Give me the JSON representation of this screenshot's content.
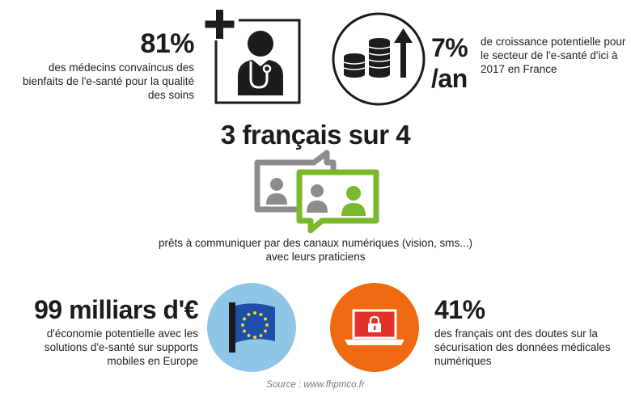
{
  "stats": {
    "doctors": {
      "value": "81%",
      "description": "des médecins convaincus des bienfaits de l'e-santé pour la qualité des soins"
    },
    "growth": {
      "value_line1": "7%",
      "value_line2": "/an",
      "description": "de croissance potentielle pour le secteur de l'e-santé d'ici à 2017 en France"
    },
    "communication": {
      "value": "3 français sur 4",
      "description": "prêts à communiquer par des canaux numériques (vision, sms...) avec leurs praticiens"
    },
    "savings": {
      "value": "99 milliars d'€",
      "description": "d'économie potentielle avec les solutions d'e-santé sur supports mobiles en Europe"
    },
    "security": {
      "value": "41%",
      "description": "des français ont des doutes sur la sécurisation des données médicales numériques"
    }
  },
  "source": "Source : www.fhpmco.fr",
  "colors": {
    "text": "#1c1c1c",
    "green": "#7ab929",
    "gray": "#8c8c8c",
    "eu_circle": "#8fc6e8",
    "eu_flag": "#1d4fa6",
    "eu_stars": "#f5d33a",
    "orange": "#ef6a10",
    "laptop_red": "#e2322b"
  },
  "icons": {
    "doctor": "doctor-plus-icon",
    "coins": "coins-growth-icon",
    "chat": "video-chat-icon",
    "eu": "eu-flag-icon",
    "laptop": "laptop-lock-icon"
  }
}
